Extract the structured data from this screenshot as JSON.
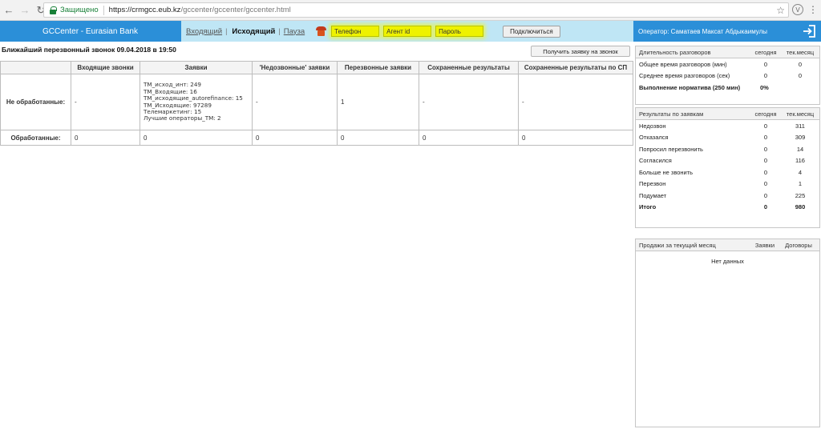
{
  "browser": {
    "secure_label": "Защищено",
    "url_host": "https://crmgcc.eub.kz",
    "url_path": "/gccenter/gccenter/gccenter.html",
    "extension_letter": "V"
  },
  "header": {
    "brand": "GCCenter - Eurasian Bank",
    "modes": {
      "incoming": "Входящий",
      "outgoing": "Исходящий",
      "pause": "Пауза"
    },
    "mode_separator": "|",
    "phone_value": "Телефон",
    "agent_id_value": "Агент id",
    "password_value": "Пароль",
    "connect_label": "Подключиться",
    "operator": "Оператор: Саматаев Максат Абдыкаимулы"
  },
  "main": {
    "nearest_call": "Ближайший перезвонный звонок 09.04.2018 в 19:50",
    "get_request_label": "Получить заявку на звонок",
    "columns": [
      "",
      "Входящие звонки",
      "Заявки",
      "'Недозвонные' заявки",
      "Перезвонные заявки",
      "Сохраненные результаты",
      "Сохраненные результаты по СП"
    ],
    "rows": [
      {
        "label": "Не обработанные:",
        "incoming": "-",
        "tickets": [
          "ТМ_исход_инт: 249",
          "ТМ_Входящие: 16",
          "ТМ_исходящие_autorefinance: 15",
          "ТМ_Исходящие: 97289",
          "Телемаркетинг: 15",
          "Лучшие операторы_ТМ: 2"
        ],
        "missed": "-",
        "callback": "1",
        "saved": "-",
        "saved_sp": "-"
      },
      {
        "label": "Обработанные:",
        "incoming": "0",
        "tickets_total": "0",
        "missed": "0",
        "callback": "0",
        "saved": "0",
        "saved_sp": "0"
      }
    ]
  },
  "duration_panel": {
    "headers": [
      "Длительность разговоров",
      "сегодня",
      "тек.месяц"
    ],
    "rows": [
      {
        "label": "Общее время разговоров (мин)",
        "today": "0",
        "month": "0"
      },
      {
        "label": "Среднее время разговоров (сек)",
        "today": "0",
        "month": "0"
      }
    ],
    "norm_label": "Выполнение норматива (250 мин)",
    "norm_value": "0%"
  },
  "results_panel": {
    "headers": [
      "Результаты по заявкам",
      "сегодня",
      "тек.месяц"
    ],
    "rows": [
      {
        "label": "Недозвон",
        "today": "0",
        "month": "311"
      },
      {
        "label": "Отказался",
        "today": "0",
        "month": "309"
      },
      {
        "label": "Попросил перезвонить",
        "today": "0",
        "month": "14"
      },
      {
        "label": "Согласился",
        "today": "0",
        "month": "116"
      },
      {
        "label": "Больше не звонить",
        "today": "0",
        "month": "4"
      },
      {
        "label": "Перезвон",
        "today": "0",
        "month": "1"
      },
      {
        "label": "Подумает",
        "today": "0",
        "month": "225"
      }
    ],
    "total": {
      "label": "Итого",
      "today": "0",
      "month": "980"
    }
  },
  "sales_panel": {
    "headers": [
      "Продажи за текущий месяц",
      "Заявки",
      "Договоры"
    ],
    "empty": "Нет данных"
  },
  "colors": {
    "header_blue": "#2b8fd8",
    "mode_bar": "#bfe6f5",
    "highlight": "#eef200"
  }
}
